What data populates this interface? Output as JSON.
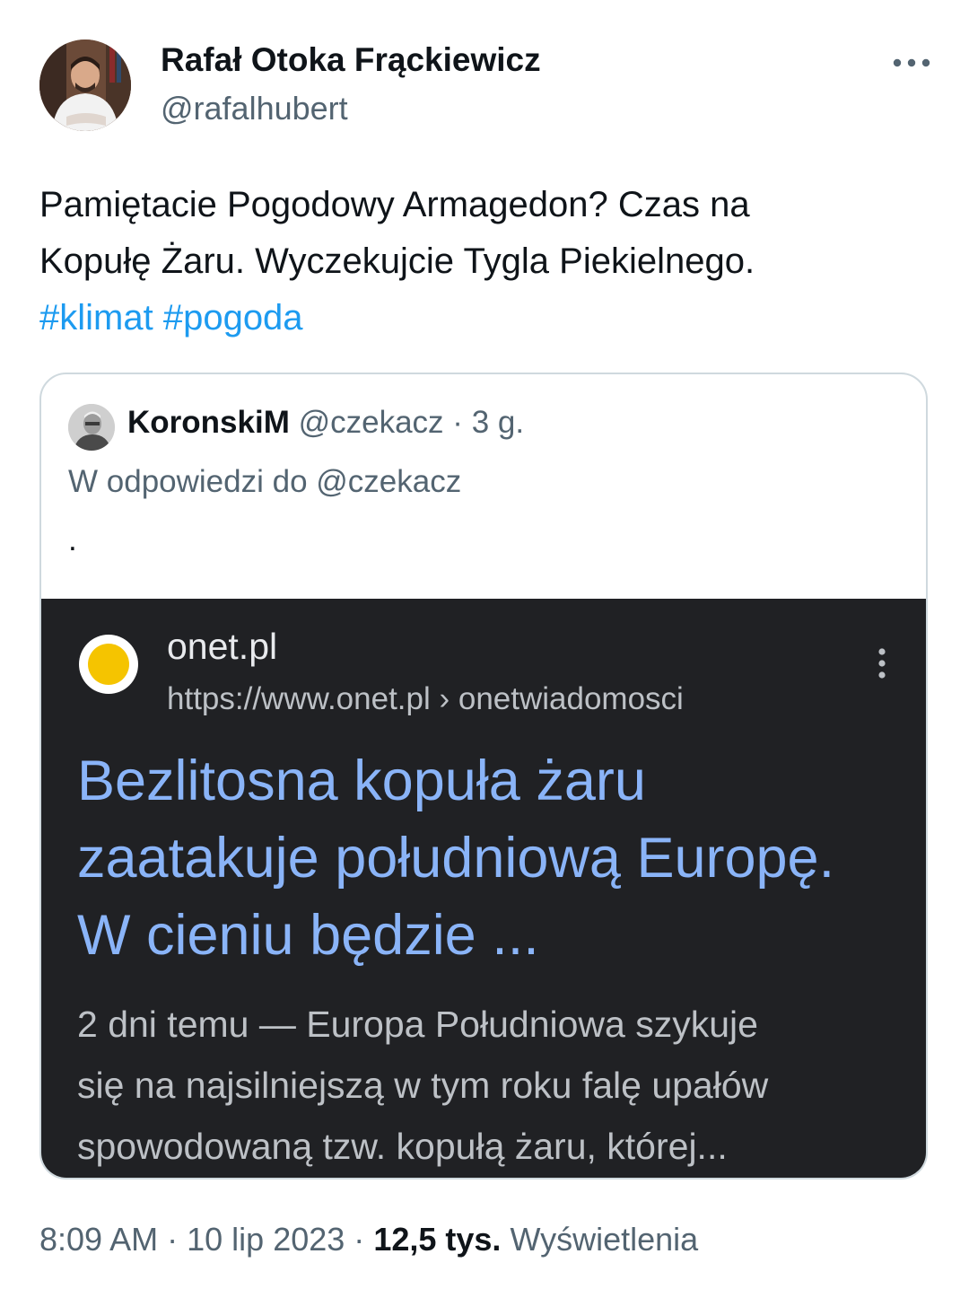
{
  "author": {
    "name": "Rafał Otoka Frąckiewicz",
    "handle": "@rafalhubert"
  },
  "tweet": {
    "text_line1": "Pamiętacie Pogodowy Armagedon?  Czas na",
    "text_line2": "Kopułę Żaru. Wyczekujcie Tygla Piekielnego.",
    "hashtags": [
      "#klimat",
      "#pogoda"
    ]
  },
  "quote": {
    "name": "KoronskiM",
    "handle": "@czekacz",
    "separator": "·",
    "time": "3 g.",
    "reply_prefix": "W odpowiedzi do",
    "reply_to": "@czekacz",
    "text": "."
  },
  "embedded_result": {
    "site_name": "onet.pl",
    "url": "https://www.onet.pl › onetwiadomosci",
    "title_lines": [
      "Bezlitosna kopuła żaru",
      "zaatakuje południową Europę.",
      "W cieniu będzie ..."
    ],
    "snippet_lines": [
      "2 dni temu — Europa Południowa szykuje",
      "się na najsilniejszą w tym roku falę upałów",
      "spowodowaną tzw. kopułą żaru, której..."
    ]
  },
  "footer": {
    "time": "8:09 AM",
    "separator": "·",
    "date": "10 lip 2023",
    "views_count": "12,5 tys.",
    "views_label": "Wyświetlenia"
  },
  "icons": {
    "more": "more-horizontal-icon",
    "result_menu": "more-vertical-icon"
  },
  "colors": {
    "link": "#1d9bf0",
    "secondary_text": "#536471",
    "result_title": "#8ab4f8",
    "result_background": "#202124",
    "site_logo": "#f5c400"
  }
}
